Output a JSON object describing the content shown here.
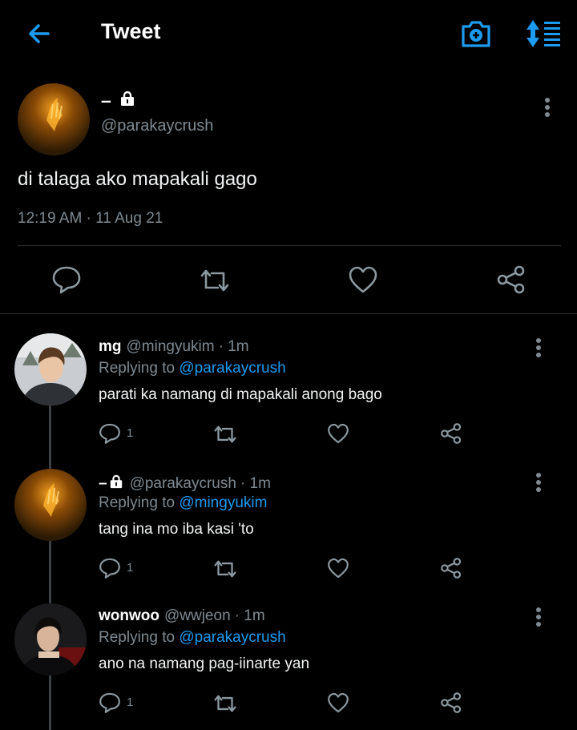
{
  "header": {
    "title": "Tweet",
    "back_icon": "arrow-left-icon",
    "camera_icon": "camera-plus-icon",
    "sort_icon": "sort-icon",
    "accent": "#1d9bf0"
  },
  "tweet": {
    "name": "–",
    "handle": "@parakaycrush",
    "text": "di talaga ako mapakali gago",
    "timestamp": "12:19 AM · 11 Aug 21"
  },
  "replies": [
    {
      "name": "mg",
      "handle": "@mingyukim",
      "time": "· 1m",
      "replying_prefix": "Replying to",
      "replying_to": "@parakaycrush",
      "text": "parati ka namang di mapakali anong bago",
      "reply_count": "1"
    },
    {
      "name": "–",
      "handle": "@parakaycrush",
      "time": "· 1m",
      "replying_prefix": "Replying to",
      "replying_to": "@mingyukim",
      "text": "tang ina mo iba kasi 'to",
      "reply_count": "1"
    },
    {
      "name": "wonwoo",
      "handle": "@wwjeon",
      "time": "· 1m",
      "replying_prefix": "Replying to",
      "replying_to": "@parakaycrush",
      "text": "ano na namang pag-iinarte yan",
      "reply_count": "1"
    }
  ]
}
